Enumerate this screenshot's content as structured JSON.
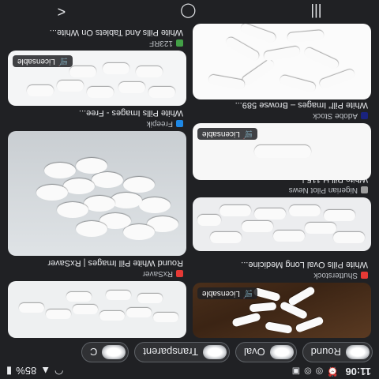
{
  "status_bar": {
    "time": "11:06",
    "battery": "85%"
  },
  "chips": [
    {
      "label": "Round",
      "has_thumb": true
    },
    {
      "label": "Oval",
      "has_thumb": true
    },
    {
      "label": "Transparent",
      "has_thumb": true
    },
    {
      "label": "C",
      "has_thumb": true
    }
  ],
  "results": [
    {
      "source": "Shutterstock",
      "title": "White Pills Oval Long Medicine...",
      "badge": "Licensable",
      "favicon_color": "#e53935"
    },
    {
      "source": "RxSaver",
      "title": "Round White Pill Images | RxSaver",
      "badge": "",
      "favicon_color": "#e53935"
    },
    {
      "source": "Nigerian Pilot News",
      "title": "White Pill H 115 |...",
      "badge": "",
      "favicon_color": "#9e9e9e"
    },
    {
      "source": "Freepik",
      "title": "White Pills Images - Free...",
      "badge": "",
      "favicon_color": "#1e88e5"
    },
    {
      "source": "Adobe Stock",
      "title": "White Pill\" Images – Browse 589...",
      "badge": "Licensable",
      "favicon_color": "#1a237e"
    },
    {
      "source": "123RF",
      "title": "White Pills And Tablets On White...",
      "badge": "Licensable",
      "favicon_color": "#43a047"
    }
  ],
  "nav": {
    "recents": "|||",
    "home": "◯",
    "back": "<"
  },
  "colors": {
    "background": "#202124",
    "text": "#e8eaed",
    "chip_border": "#5f6368"
  }
}
